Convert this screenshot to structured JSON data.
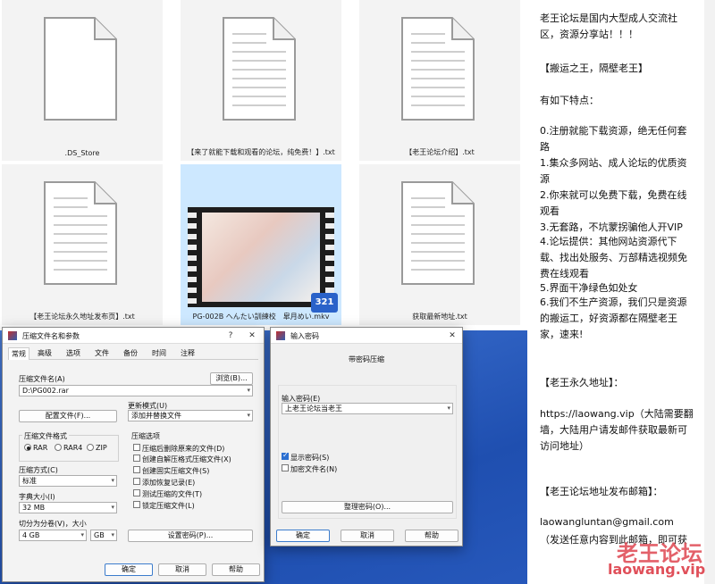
{
  "explorer": {
    "files": [
      {
        "name": ".DS_Store"
      },
      {
        "name": "【来了就能下载和观看的论坛，纯免费！】.txt"
      },
      {
        "name": "【老王论坛介绍】.txt"
      },
      {
        "name": "【老王论坛永久地址发布页】.txt"
      },
      {
        "name": "PG-002B へんたい訓練校　皐月めい.mkv",
        "badge": "321"
      },
      {
        "name": "获取最新地址.txt"
      }
    ]
  },
  "textpanel": {
    "lines": [
      "老王论坛是国内大型成人交流社区，资源分享站！！！",
      "【搬运之王，隔壁老王】",
      "有如下特点：",
      "0.注册就能下载资源，绝无任何套路",
      "1.集众多网站、成人论坛的优质资源",
      "2.你来就可以免费下载，免费在线观看",
      "3.无套路，不坑蒙拐骗他人开VIP",
      "4.论坛提供：其他网站资源代下载、找出处服务、万部精选视频免费在线观看",
      "5.界面干净绿色如处女",
      "6.我们不生产资源，我们只是资源的搬运工，好资源都在隔壁老王家，速来!",
      "【老王永久地址】：",
      "https://laowang.vip（大陆需要翻墙，大陆用户请发邮件获取最新可访问地址）",
      "【老王论坛地址发布邮箱】：",
      "laowangluntan@gmail.com",
      "（发送任意内容到此邮箱，即可获"
    ],
    "watermark_cn": "老王论坛",
    "watermark_url": "laowang.vip"
  },
  "archive_dialog": {
    "title": "压缩文件名和参数",
    "help_btn": "?",
    "close_btn": "✕",
    "tabs": [
      "常规",
      "高级",
      "选项",
      "文件",
      "备份",
      "时间",
      "注释"
    ],
    "archive_name_label": "压缩文件名(A)",
    "archive_name_value": "D:\\PG002.rar",
    "browse_btn": "浏览(B)...",
    "update_mode_label": "更新模式(U)",
    "update_mode_value": "添加并替换文件",
    "profiles_btn": "配置文件(F)...",
    "format_group": "压缩文件格式",
    "formats": [
      "RAR",
      "RAR4",
      "ZIP"
    ],
    "selected_format": "RAR",
    "options_group": "压缩选项",
    "options": [
      {
        "label": "压缩后删除原来的文件(D)",
        "checked": false
      },
      {
        "label": "创建自解压格式压缩文件(X)",
        "checked": false
      },
      {
        "label": "创建固实压缩文件(S)",
        "checked": false
      },
      {
        "label": "添加恢复记录(E)",
        "checked": false
      },
      {
        "label": "测试压缩的文件(T)",
        "checked": false
      },
      {
        "label": "锁定压缩文件(L)",
        "checked": false
      }
    ],
    "method_label": "压缩方式(C)",
    "method_value": "标准",
    "dict_label": "字典大小(I)",
    "dict_value": "32 MB",
    "split_label": "切分为分卷(V)，大小",
    "split_value": "4 GB",
    "split_unit": "GB",
    "set_password_btn": "设置密码(P)...",
    "ok_btn": "确定",
    "cancel_btn": "取消",
    "help_btn2": "帮助"
  },
  "password_dialog": {
    "title": "输入密码",
    "close_btn": "✕",
    "heading": "带密码压缩",
    "enter_label": "输入密码(E)",
    "password_value": "上老王论坛当老王",
    "show_password": {
      "label": "显示密码(S)",
      "checked": true
    },
    "encrypt_names": {
      "label": "加密文件名(N)",
      "checked": false
    },
    "organize_btn": "整理密码(O)...",
    "ok_btn": "确定",
    "cancel_btn": "取消",
    "help_btn": "帮助"
  },
  "colors": {
    "accent": "#2b6fd1",
    "selected_tile": "#cde8ff",
    "watermark": "#e0505a"
  }
}
